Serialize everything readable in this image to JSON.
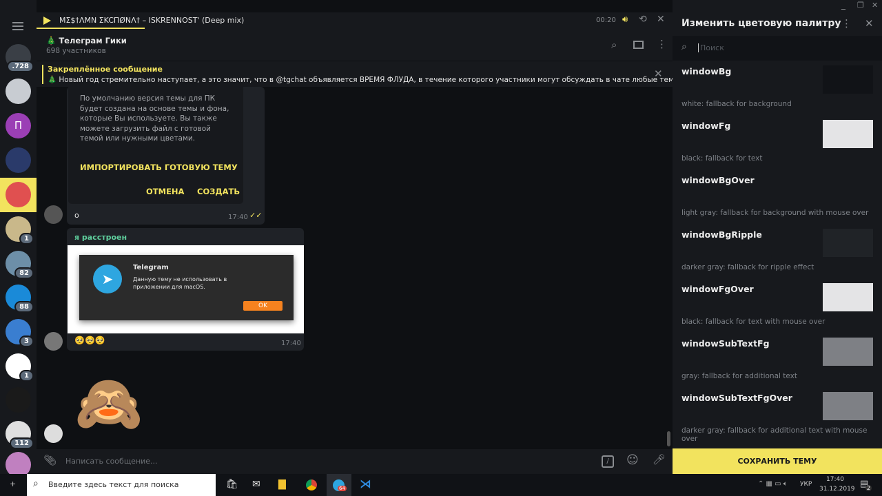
{
  "window": {
    "controls": [
      "minimize",
      "restore",
      "close"
    ]
  },
  "sidebar": {
    "badges": [
      ".728",
      "",
      "",
      "",
      "",
      "1",
      "82",
      "88",
      "3",
      "1",
      "",
      "112",
      ""
    ],
    "avatar_colors": [
      "#3a3f46",
      "#c8ccd2",
      "#9b3fb5",
      "#2a3a6a",
      "#e05050",
      "#c9b88a",
      "#6d8fa8",
      "#1a8ad8",
      "#3a7ed0",
      "#ffffff",
      "#1a1a1a",
      "#e0e0e0",
      "#c080c0"
    ],
    "avatar_letter_2": "П"
  },
  "player": {
    "track": "MΣ$†ΛMN ΣKCПØNΛ† – ISKRENNOST' (Deep mix)",
    "time": "00:20",
    "progress_percent": 17
  },
  "chat": {
    "title": "🎄 Телеграм Гики",
    "subtitle": "698 участников"
  },
  "pinned": {
    "label": "Закреплённое сообщение",
    "text": "🎄 Новый год стремительно наступает, а это значит, что в @tgchat объявляется ВРЕМЯ ФЛУДА, в течение которого участники могут обсуждать в чате любые темы, а не т..."
  },
  "messages": [
    {
      "dialog_text": "По умолчанию версия темы для ПК будет создана на основе темы и фона, которые Вы используете. Вы также можете загрузить файл с готовой темой или нужными цветами.",
      "import": "ИМПОРТИРОВАТЬ ГОТОВУЮ ТЕМУ",
      "cancel": "ОТМЕНА",
      "create": "СОЗДАТЬ",
      "caption": "о",
      "time": "17:40"
    },
    {
      "sender": "я расстроен",
      "alert_title": "Telegram",
      "alert_text": "Данную тему не использовать в приложении для macOS.",
      "alert_ok": "OK",
      "caption": "🥺🥺🥺",
      "time": "17:40"
    },
    {
      "sticker": "🙈"
    }
  ],
  "input": {
    "placeholder": "Написать сообщение..."
  },
  "panel": {
    "title": "Изменить цветовую палитру",
    "search_placeholder": "Поиск",
    "save": "СОХРАНИТЬ ТЕМУ",
    "rows": [
      {
        "name": "windowBg",
        "desc": "white: fallback for background",
        "color": "#111317"
      },
      {
        "name": "windowFg",
        "desc": "black: fallback for text",
        "color": "#e4e4e6"
      },
      {
        "name": "windowBgOver",
        "desc": "light gray: fallback for background with mouse over",
        "color": "#17191d"
      },
      {
        "name": "windowBgRipple",
        "desc": "darker gray: fallback for ripple effect",
        "color": "#202327"
      },
      {
        "name": "windowFgOver",
        "desc": "black: fallback for text with mouse over",
        "color": "#e4e4e6"
      },
      {
        "name": "windowSubTextFg",
        "desc": "gray: fallback for additional text",
        "color": "#7e8085"
      },
      {
        "name": "windowSubTextFgOver",
        "desc": "darker gray: fallback for additional text with mouse over",
        "color": "#7e8085"
      }
    ]
  },
  "taskbar": {
    "search_placeholder": "Введите здесь текст для поиска",
    "lang": "УКР",
    "time": "17:40",
    "date": "31.12.2019",
    "telegram_badge": "64",
    "notif_count": "2"
  },
  "accent": "#f2e35e"
}
